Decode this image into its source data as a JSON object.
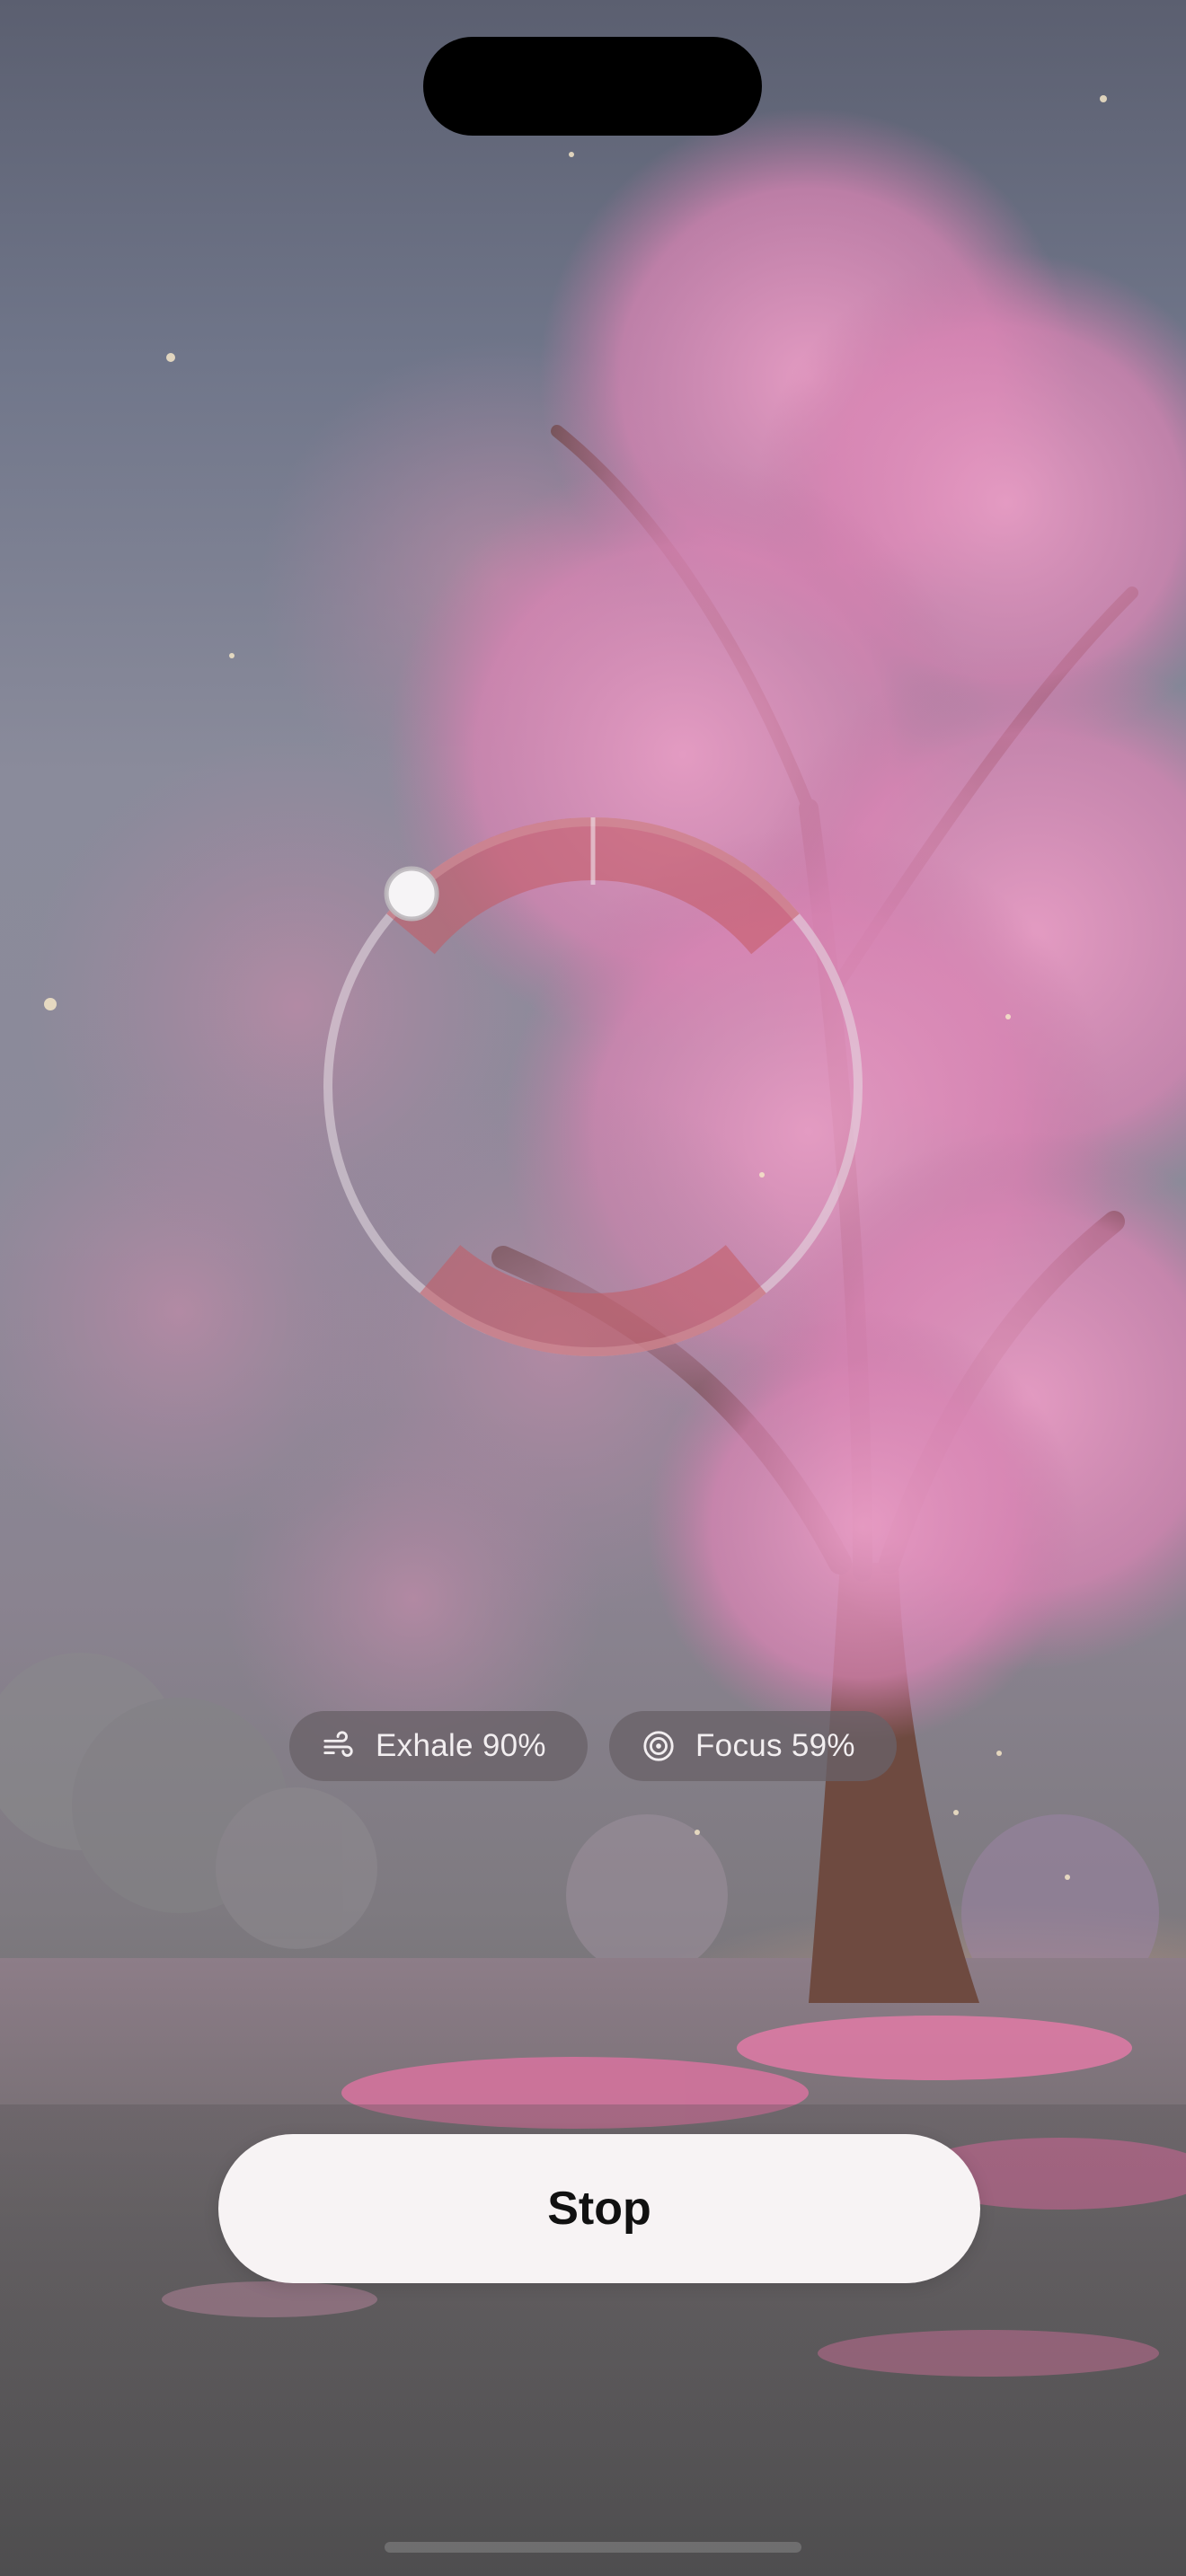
{
  "stats": {
    "exhale": {
      "label": "Exhale 90%",
      "icon": "wind-icon",
      "value_percent": 90
    },
    "focus": {
      "label": "Focus 59%",
      "icon": "target-icon",
      "value_percent": 59
    }
  },
  "controls": {
    "stop_label": "Stop"
  },
  "ring": {
    "progress_fraction": 0.88,
    "accent_color": "#c45a62"
  },
  "background": {
    "scene": "cherry-blossom-tree",
    "blossom_color": "#e58fb6"
  }
}
